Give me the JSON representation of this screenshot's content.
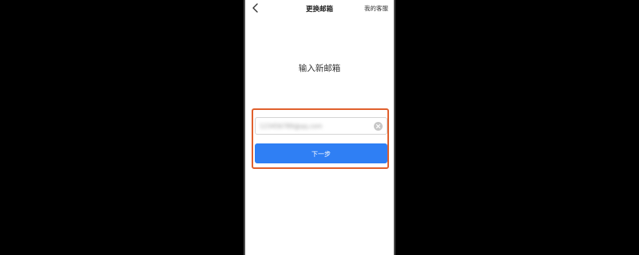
{
  "nav": {
    "title": "更换邮箱",
    "customer_service": "我的客服",
    "back_icon": "chevron-left-icon"
  },
  "main": {
    "heading": "输入新邮箱",
    "email_value": "123456789@qq.com",
    "clear_icon": "clear-circle-icon",
    "next_label": "下一步"
  },
  "colors": {
    "accent": "#2f7ff4",
    "highlight": "#e0602d",
    "background": "#000000"
  }
}
